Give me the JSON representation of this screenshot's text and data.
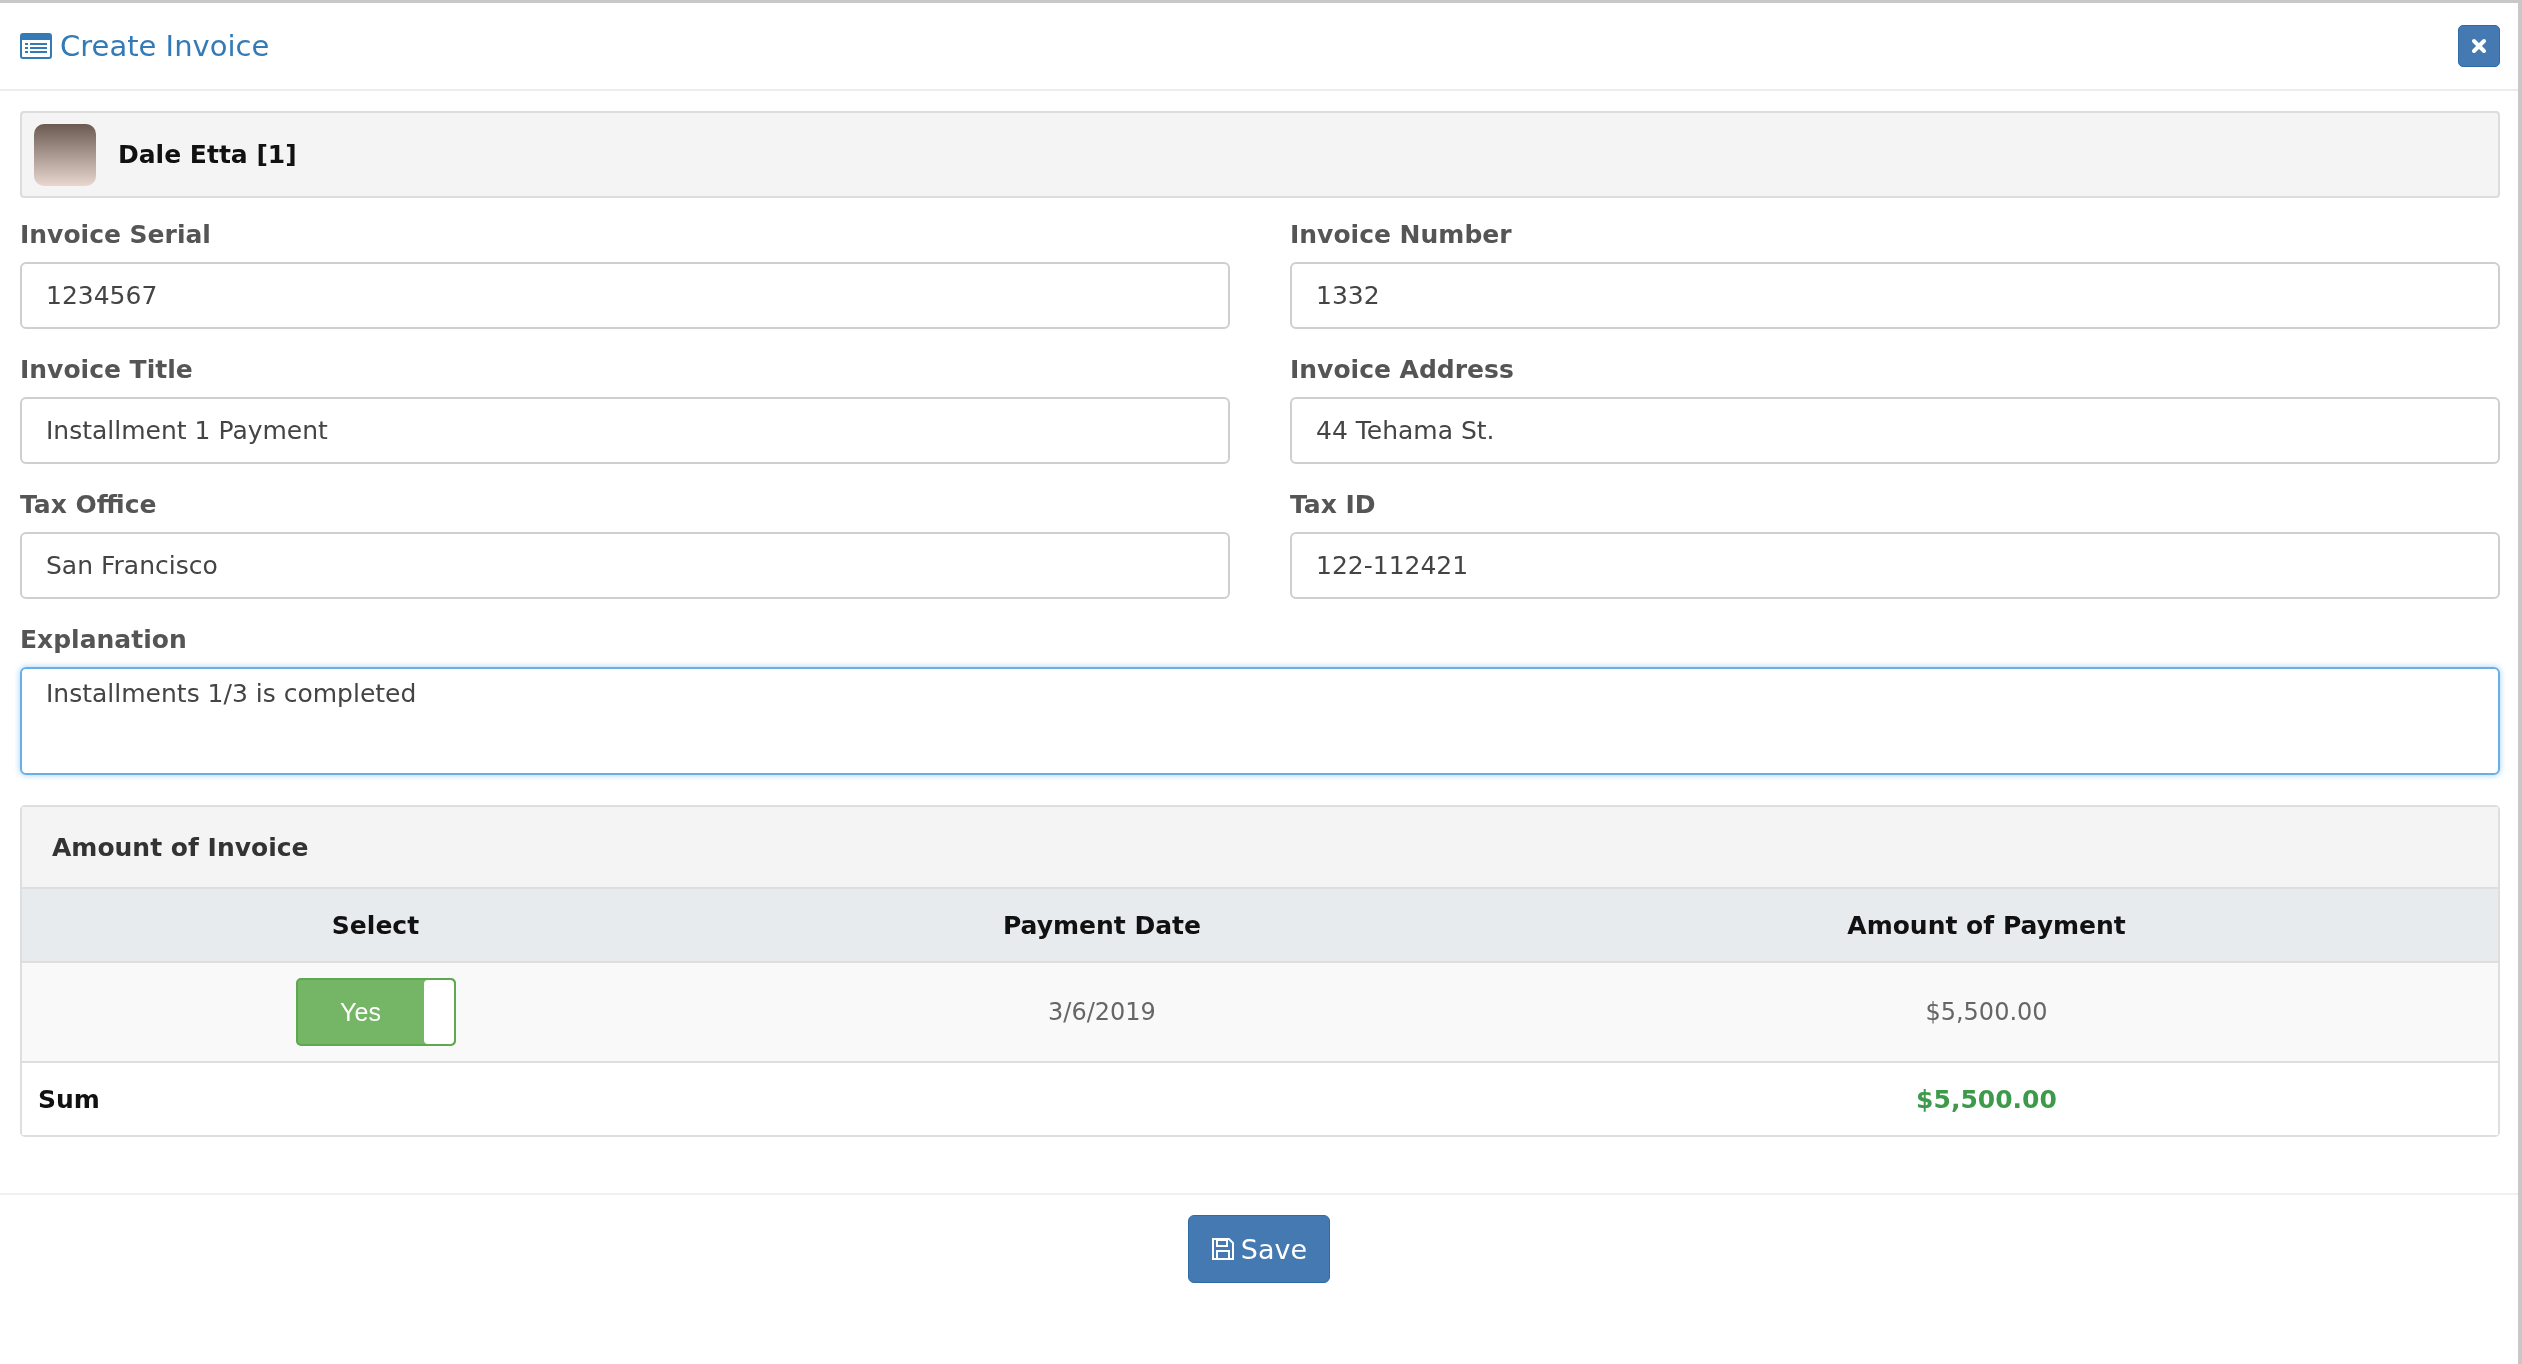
{
  "window": {
    "title": "Create Invoice"
  },
  "customer": {
    "name": "Dale Etta [1]"
  },
  "fields": [
    {
      "label": "Invoice Serial",
      "value": "1234567"
    },
    {
      "label": "Invoice Number",
      "value": "1332"
    },
    {
      "label": "Invoice Title",
      "value": "Installment 1 Payment"
    },
    {
      "label": "Invoice Address",
      "value": "44 Tehama St."
    },
    {
      "label": "Tax Office",
      "value": "San Francisco"
    },
    {
      "label": "Tax ID",
      "value": "122-112421"
    }
  ],
  "explanation": {
    "label": "Explanation",
    "value": "Installments 1/3 is completed",
    "focused": true
  },
  "amount_panel": {
    "title": "Amount of Invoice",
    "columns": [
      "Select",
      "Payment Date",
      "Amount of Payment"
    ],
    "rows": [
      {
        "toggle": {
          "label": "Yes",
          "on": true
        },
        "payment_date": "3/6/2019",
        "amount": "$5,500.00"
      }
    ],
    "sum": {
      "label": "Sum",
      "value": "$5,500.00"
    }
  },
  "buttons": [
    {
      "label": "Save"
    }
  ]
}
